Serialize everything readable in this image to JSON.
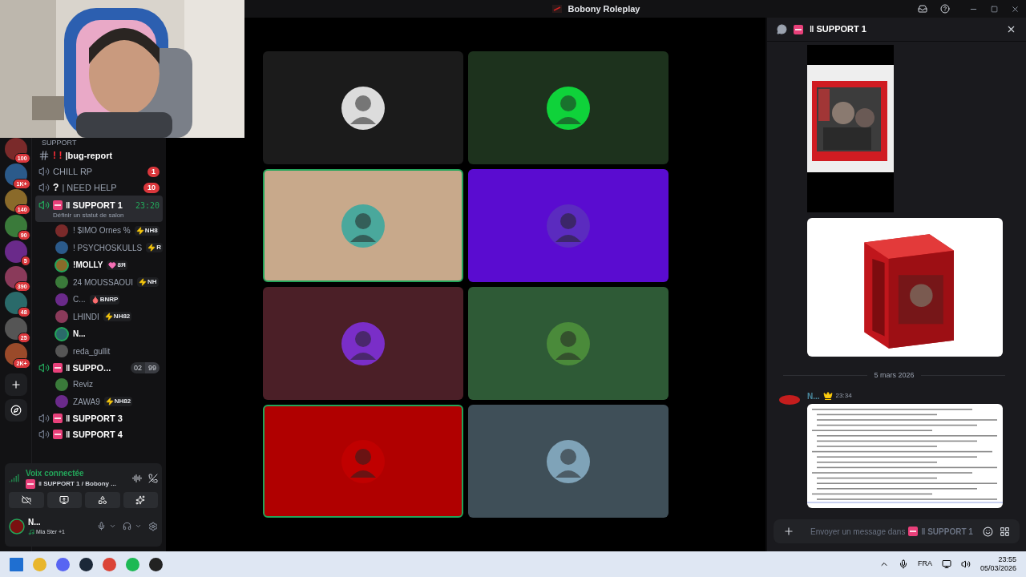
{
  "window": {
    "title": "Bobony Roleplay"
  },
  "servers": [
    {
      "badge": "100"
    },
    {
      "badge": "1K+"
    },
    {
      "badge": "140"
    },
    {
      "badge": "90"
    },
    {
      "badge": "5"
    },
    {
      "badge": "390"
    },
    {
      "badge": "48"
    },
    {
      "badge": "25"
    },
    {
      "badge": "2K+"
    }
  ],
  "category": "SUPPORT",
  "channels": [
    {
      "kind": "text",
      "prefix": "! !",
      "name": "|bug-report",
      "selected": false
    },
    {
      "kind": "voice",
      "name": "CHILL RP",
      "badge": "1",
      "active": false,
      "selected": false
    },
    {
      "kind": "voice",
      "prefix": "?",
      "name": "| NEED HELP",
      "badge": "10",
      "active": false,
      "selected": false
    },
    {
      "kind": "voice",
      "sos": true,
      "name": "ǁ SUPPORT 1",
      "time": "23:20",
      "status": "Définir un statut de salon",
      "active": true,
      "selected": true,
      "members": [
        {
          "name": "! $IMO Ornes %",
          "tag": "NH8",
          "kind": "bolt",
          "speaking": false
        },
        {
          "name": "! PSYCHOSKULLS",
          "tag": "R",
          "kind": "bolt",
          "speaking": false
        },
        {
          "name": "!MOLLY",
          "tag": "8Я",
          "kind": "lips",
          "speaking": true
        },
        {
          "name": "24 MOUSSAOUI",
          "tag": "NH",
          "kind": "bolt",
          "speaking": false
        },
        {
          "name": "C...",
          "tag": "BNRP",
          "kind": "drop",
          "speaking": false
        },
        {
          "name": "LHINDI",
          "tag": "NH82",
          "kind": "bolt",
          "speaking": false
        },
        {
          "name": "N...",
          "speaking": true
        },
        {
          "name": "reda_gullit",
          "speaking": false
        }
      ]
    },
    {
      "kind": "voice",
      "sos": true,
      "name": "ǁ SUPPO...",
      "counts": [
        "02",
        "99"
      ],
      "active": true,
      "selected": false,
      "members": [
        {
          "name": "Reviz",
          "speaking": false
        },
        {
          "name": "ZAWA9",
          "tag": "NH82",
          "kind": "bolt",
          "speaking": false
        }
      ]
    },
    {
      "kind": "voice",
      "sos": true,
      "name": "ǁ SUPPORT 3",
      "active": false,
      "selected": false
    },
    {
      "kind": "voice",
      "sos": true,
      "name": "ǁ SUPPORT 4",
      "active": false,
      "selected": false
    }
  ],
  "voice_panel": {
    "status": "Voix connectée",
    "channel": "ǁ SUPPORT 1 / Bobony ..."
  },
  "user_panel": {
    "name": "N...",
    "activity": "Mia Ster +1"
  },
  "video_tiles": [
    {
      "color": "#1b1b1b",
      "speaking": false
    },
    {
      "color": "#1d321d",
      "speaking": false
    },
    {
      "color": "#c8a98b",
      "speaking": true
    },
    {
      "color": "#5a0cd0",
      "speaking": false
    },
    {
      "color": "#4b1f27",
      "speaking": false
    },
    {
      "color": "#2e5a36",
      "speaking": false
    },
    {
      "color": "#b00000",
      "speaking": true
    },
    {
      "color": "#3f4f58",
      "speaking": false
    }
  ],
  "chat": {
    "title": "ǁ SUPPORT 1",
    "date_divider": "5 mars 2026",
    "message": {
      "author": "N...",
      "time": "23:34"
    },
    "input": {
      "placeholder": "Envoyer un message dans",
      "channel": "ǁ SUPPORT 1"
    }
  },
  "taskbar": {
    "language": "FRA",
    "time": "23:55",
    "date": "05/03/2026"
  }
}
